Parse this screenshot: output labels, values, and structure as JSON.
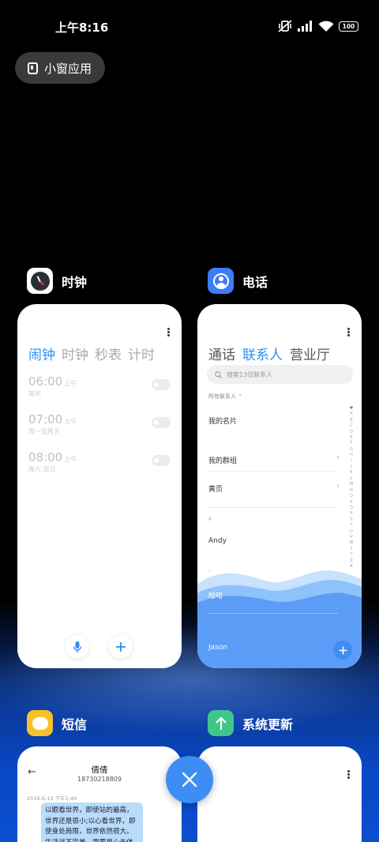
{
  "status_bar": {
    "time": "上午8:16",
    "battery": "100"
  },
  "small_window": {
    "label": "小窗应用"
  },
  "cards": {
    "clock": {
      "app_name": "时钟",
      "tabs": [
        "闹钟",
        "时钟",
        "秒表",
        "计时"
      ],
      "alarms": [
        {
          "time": "06:00",
          "ampm": "上午",
          "days": "每天"
        },
        {
          "time": "07:00",
          "ampm": "上午",
          "days": "周一至周五"
        },
        {
          "time": "08:00",
          "ampm": "上午",
          "days": "周六 周日"
        }
      ]
    },
    "phone": {
      "app_name": "电话",
      "tabs": [
        "通话",
        "联系人",
        "营业厅"
      ],
      "search_placeholder": "搜索13位联系人",
      "filter": "所有联系人",
      "rows": {
        "my_card": "我的名片",
        "groups": "我的群组",
        "yellow_pages": "黄页",
        "section_a": "A",
        "andy": "Andy",
        "section_h": "H",
        "haha": "哈哈",
        "jason": "Jason"
      },
      "alphabet": [
        "A",
        "B",
        "C",
        "D",
        "E",
        "F",
        "G",
        "H",
        "I",
        "J",
        "K",
        "L",
        "M",
        "N",
        "O",
        "P",
        "Q",
        "R",
        "S",
        "T",
        "U",
        "V",
        "W",
        "X",
        "Y",
        "Z",
        "#"
      ]
    },
    "sms": {
      "app_name": "短信",
      "contact_name": "倩倩",
      "contact_number": "18730218809",
      "timestamp": "2016-6-13 下午1:49",
      "message": "以眼看世界，即使站的最高，世界还是很小;以心看世界，即使身处局限，世界依然很大。生活远不完美，需要用心去体会;不管拥"
    },
    "update": {
      "app_name": "系统更新"
    }
  },
  "colors": {
    "accent": "#2a8ff7",
    "close_button": "#3d8ef4",
    "bubble": "#b8dcfb"
  }
}
